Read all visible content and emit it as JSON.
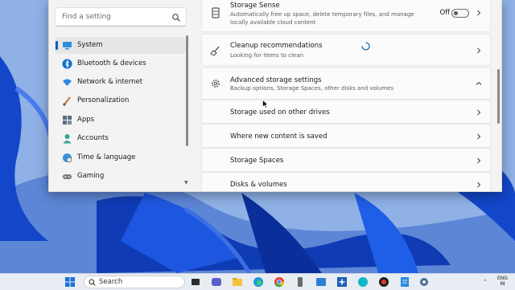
{
  "sidebar": {
    "search_placeholder": "Find a setting",
    "items": [
      {
        "label": "System",
        "icon": "monitor-icon",
        "active": true
      },
      {
        "label": "Bluetooth & devices",
        "icon": "bluetooth-icon"
      },
      {
        "label": "Network & internet",
        "icon": "wifi-icon"
      },
      {
        "label": "Personalization",
        "icon": "brush-icon"
      },
      {
        "label": "Apps",
        "icon": "apps-icon"
      },
      {
        "label": "Accounts",
        "icon": "person-icon"
      },
      {
        "label": "Time & language",
        "icon": "globe-clock-icon"
      },
      {
        "label": "Gaming",
        "icon": "controller-icon"
      }
    ]
  },
  "main": {
    "storage_sense": {
      "title": "Storage Sense",
      "subtitle": "Automatically free up space, delete temporary files, and manage locally available cloud content",
      "toggle_state": "Off"
    },
    "cleanup": {
      "title": "Cleanup recommendations",
      "subtitle": "Looking for items to clean"
    },
    "advanced": {
      "title": "Advanced storage settings",
      "subtitle": "Backup options, Storage Spaces, other disks and volumes",
      "expanded": true,
      "items": [
        {
          "label": "Storage used on other drives"
        },
        {
          "label": "Where new content is saved"
        },
        {
          "label": "Storage Spaces"
        },
        {
          "label": "Disks & volumes"
        }
      ]
    }
  },
  "taskbar": {
    "search_label": "Search",
    "lang_line1": "ENG",
    "lang_line2": "IN"
  }
}
